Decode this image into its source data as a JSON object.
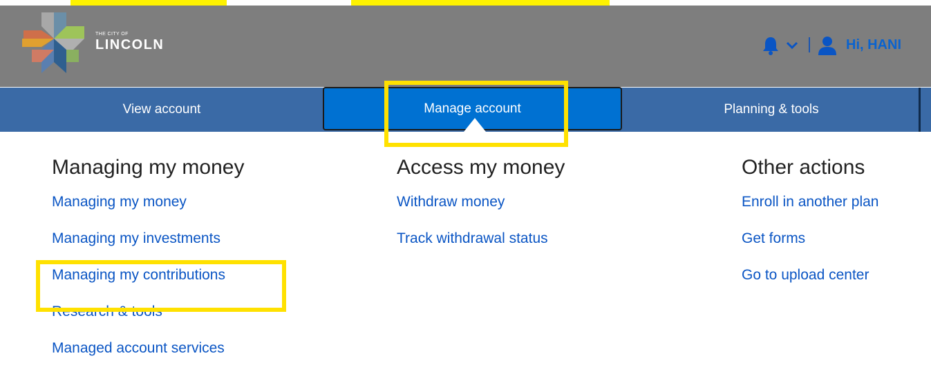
{
  "brand": {
    "small": "THE CITY OF",
    "name": "LINCOLN"
  },
  "header": {
    "greeting": "Hi, HANI",
    "icons": [
      "bell-icon",
      "chevron-down-icon",
      "user-icon"
    ]
  },
  "nav": {
    "tabs": [
      {
        "label": "View account"
      },
      {
        "label": "Manage account"
      },
      {
        "label": "Planning & tools"
      }
    ],
    "active_tab": "Manage account"
  },
  "menu": {
    "columns": [
      {
        "title": "Managing my money",
        "links": [
          "Managing my money",
          "Managing my investments",
          "Managing my contributions",
          "Research & tools",
          "Managed account services"
        ]
      },
      {
        "title": "Access my money",
        "links": [
          "Withdraw money",
          "Track withdrawal status"
        ]
      },
      {
        "title": "Other actions",
        "links": [
          "Enroll in another plan",
          "Get forms",
          "Go to upload center"
        ]
      }
    ]
  },
  "colors": {
    "nav_bar": "#3a6aa6",
    "active_tab": "#0071d2",
    "link": "#0a55c4",
    "highlight": "#ffe100",
    "header_bg": "#7e7e7e"
  }
}
